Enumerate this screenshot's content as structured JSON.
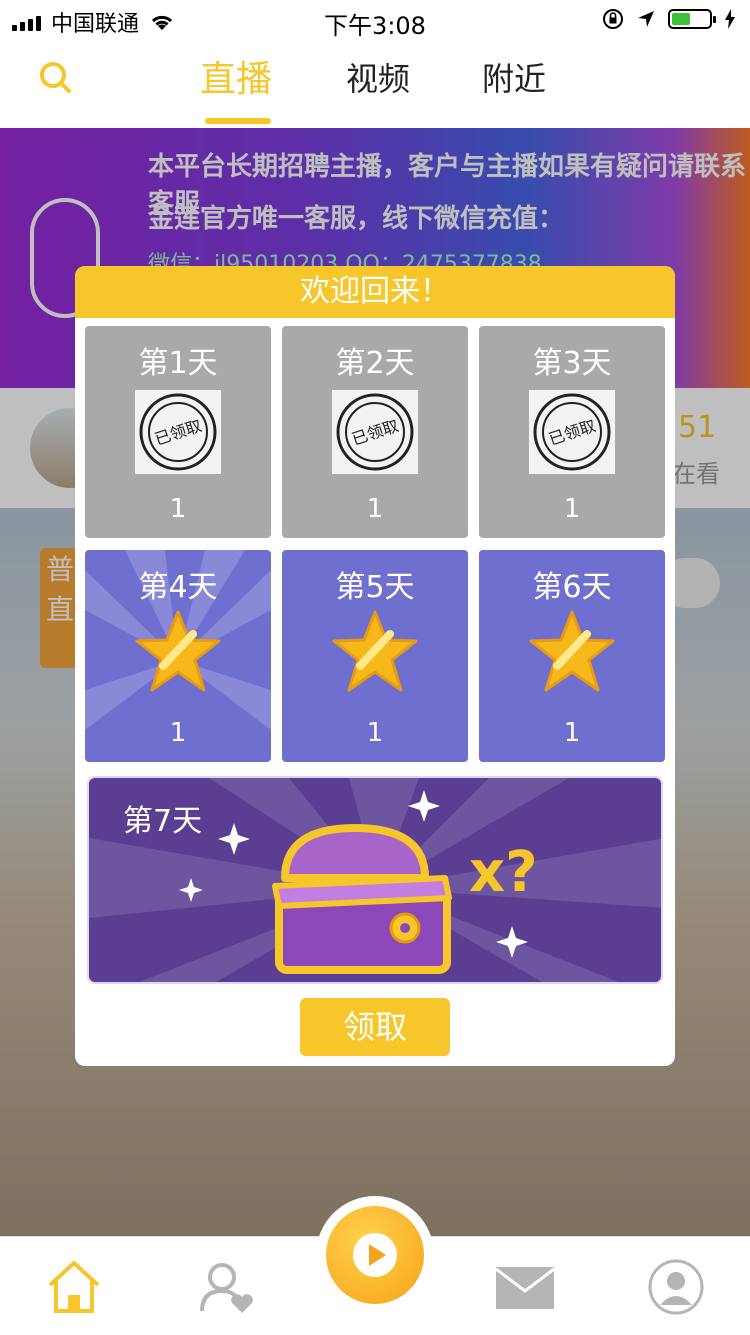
{
  "status_bar": {
    "carrier": "中国联通",
    "time": "下午3:08"
  },
  "nav": {
    "tabs": [
      "直播",
      "视频",
      "附近"
    ],
    "active_tab": 0
  },
  "banner": {
    "line1": "本平台长期招聘主播，客户与主播如果有疑问请联系客服",
    "line2": "金莲官方唯一客服，线下微信充值：",
    "line3": "微信：jl95010203    QQ：2475377838"
  },
  "user_card": {
    "viewers": "51",
    "viewers_label": "在看"
  },
  "feed": {
    "tag": "普直"
  },
  "modal": {
    "title": "欢迎回来！",
    "claimed_stamp": "已领取",
    "days": [
      {
        "label": "第1天",
        "value": "1",
        "status": "claimed"
      },
      {
        "label": "第2天",
        "value": "1",
        "status": "claimed"
      },
      {
        "label": "第3天",
        "value": "1",
        "status": "claimed"
      },
      {
        "label": "第4天",
        "value": "1",
        "status": "pending"
      },
      {
        "label": "第5天",
        "value": "1",
        "status": "pending"
      },
      {
        "label": "第6天",
        "value": "1",
        "status": "pending"
      }
    ],
    "day7": {
      "label": "第7天",
      "reward": "x?"
    },
    "claim_button": "领取"
  },
  "colors": {
    "accent": "#f6c62a",
    "pending_day": "#6f6fcf",
    "claimed_day": "#a9a9a9",
    "chest_bg": "#5a3e92"
  },
  "icons": [
    "search-icon",
    "home-icon",
    "follow-icon",
    "play-icon",
    "mail-icon",
    "profile-icon",
    "star-icon",
    "treasure-chest-icon",
    "stamp-icon",
    "wifi-icon",
    "location-icon",
    "battery-icon"
  ]
}
